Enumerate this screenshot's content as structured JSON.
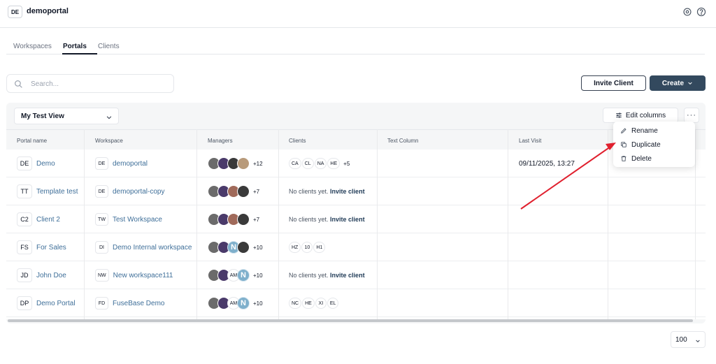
{
  "header": {
    "badge": "DE",
    "title": "demoportal",
    "icons": [
      "settings-icon",
      "help-icon"
    ]
  },
  "tabs": [
    {
      "label": "Workspaces",
      "active": false
    },
    {
      "label": "Portals",
      "active": true
    },
    {
      "label": "Clients",
      "active": false
    }
  ],
  "search": {
    "placeholder": "Search..."
  },
  "actions": {
    "invite_label": "Invite Client",
    "create_label": "Create"
  },
  "view": {
    "selected": "My Test View",
    "edit_columns_label": "Edit columns",
    "more_label": "···"
  },
  "columns": [
    "Portal name",
    "Workspace",
    "Managers",
    "Clients",
    "Text Column",
    "Last Visit"
  ],
  "rows": [
    {
      "code": "DE",
      "portal": "Demo",
      "ws_code": "DE",
      "workspace": "demoportal",
      "managers": [
        "photo",
        "photo",
        "photo",
        "photo"
      ],
      "managers_more": "+12",
      "clients": [
        "CA",
        "CL",
        "NA",
        "HE"
      ],
      "clients_more": "+5",
      "clients_empty": "",
      "last_visit": "09/11/2025, 13:27"
    },
    {
      "code": "TT",
      "portal": "Template test",
      "ws_code": "DE",
      "workspace": "demoportal-copy",
      "managers": [
        "photo",
        "photo",
        "photo",
        "photo"
      ],
      "managers_more": "+7",
      "clients": [],
      "clients_more": "",
      "clients_empty": "No clients yet.",
      "last_visit": ""
    },
    {
      "code": "C2",
      "portal": "Client 2",
      "ws_code": "TW",
      "workspace": "Test Workspace",
      "managers": [
        "photo",
        "photo",
        "photo",
        "photo"
      ],
      "managers_more": "+7",
      "clients": [],
      "clients_more": "",
      "clients_empty": "No clients yet.",
      "last_visit": ""
    },
    {
      "code": "FS",
      "portal": "For Sales",
      "ws_code": "DI",
      "workspace": "Demo Internal workspace",
      "managers": [
        "photo",
        "photo",
        "N",
        "photo"
      ],
      "managers_more": "+10",
      "clients": [
        "HZ",
        "10",
        "H1"
      ],
      "clients_more": "",
      "clients_empty": "",
      "last_visit": ""
    },
    {
      "code": "JD",
      "portal": "John Doe",
      "ws_code": "NW",
      "workspace": "New workspace111",
      "managers": [
        "photo",
        "photo",
        "AM",
        "N"
      ],
      "managers_more": "+10",
      "clients": [],
      "clients_more": "",
      "clients_empty": "No clients yet.",
      "last_visit": ""
    },
    {
      "code": "DP",
      "portal": "Demo Portal",
      "ws_code": "FD",
      "workspace": "FuseBase Demo",
      "managers": [
        "photo",
        "photo",
        "AM",
        "N"
      ],
      "managers_more": "+10",
      "clients": [
        "NC",
        "HE",
        "XI",
        "EL"
      ],
      "clients_more": "",
      "clients_empty": "",
      "last_visit": ""
    }
  ],
  "invite_client_link": "Invite client",
  "menu": [
    {
      "label": "Rename",
      "icon": "pencil-icon"
    },
    {
      "label": "Duplicate",
      "icon": "copy-icon"
    },
    {
      "label": "Delete",
      "icon": "trash-icon"
    }
  ],
  "page_size": {
    "value": "100"
  },
  "colors": {
    "primary": "#33495e",
    "link": "#3f6f99",
    "annotation_arrow": "#e0202e"
  }
}
